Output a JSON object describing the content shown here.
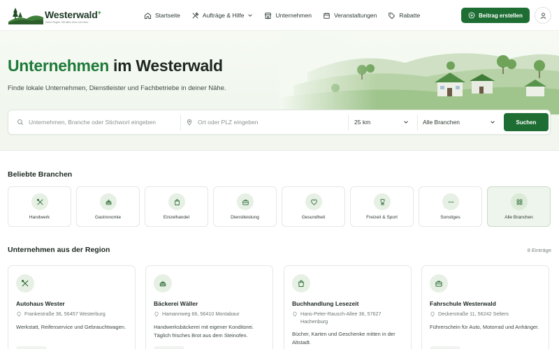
{
  "brand": {
    "name": "Westerwald",
    "plus": "+",
    "tagline": "Deine Region. Mit allem drum und dran."
  },
  "nav": {
    "items": [
      {
        "label": "Startseite",
        "icon": "home-icon"
      },
      {
        "label": "Aufträge & Hilfe",
        "icon": "tools-icon",
        "has_dropdown": true
      },
      {
        "label": "Unternehmen",
        "icon": "store-icon"
      },
      {
        "label": "Veranstaltungen",
        "icon": "calendar-icon"
      },
      {
        "label": "Rabatte",
        "icon": "tag-icon"
      }
    ],
    "create_button": "Beitrag erstellen",
    "user_icon": "user-icon"
  },
  "hero": {
    "title_highlight": "Unternehmen",
    "title_rest": " im Westerwald",
    "subtitle": "Finde lokale Unternehmen, Dienstleister und Fachbetriebe in deiner Nähe."
  },
  "search": {
    "query_placeholder": "Unternehmen, Branche oder Stichwort eingeben",
    "location_placeholder": "Ort oder PLZ eingeben",
    "radius": "25 km",
    "branch": "Alle Branchen",
    "button": "Suchen"
  },
  "categories": {
    "title": "Beliebte Branchen",
    "items": [
      {
        "label": "Handwerk",
        "icon": "tools-icon"
      },
      {
        "label": "Gastronomie",
        "icon": "cake-icon"
      },
      {
        "label": "Einzelhandel",
        "icon": "shopping-bag-icon"
      },
      {
        "label": "Dienstleistung",
        "icon": "briefcase-icon"
      },
      {
        "label": "Gesundheit",
        "icon": "heart-icon"
      },
      {
        "label": "Freizeit & Sport",
        "icon": "trophy-icon"
      },
      {
        "label": "Sonstiges",
        "icon": "more-icon"
      },
      {
        "label": "Alle Branchen",
        "icon": "grid-icon",
        "active": true
      }
    ]
  },
  "companies": {
    "title": "Unternehmen aus der Region",
    "count": "8 Einträge",
    "items": [
      {
        "name": "Autohaus Wester",
        "address": "Frankestraße 36, 56457 Westerburg",
        "description": "Werkstatt, Reifenservice und Gebrauchtwagen.",
        "icon": "tools-icon"
      },
      {
        "name": "Bäckerei Wäller",
        "address": "Hamannweg 66, 56410 Montabaur",
        "description": "Handwerksbäckerei mit eigener Konditorei. Täglich frisches Brot aus dem Steinofen.",
        "icon": "cake-icon"
      },
      {
        "name": "Buchhandlung Lesezeit",
        "address": "Hans-Peter-Rausch-Allee 36, 57627 Hachenburg",
        "description": "Bücher, Karten und Geschenke mitten in der Altstadt.",
        "icon": "shopping-bag-icon"
      },
      {
        "name": "Fahrschule Westerwald",
        "address": "Deckerstraße 11, 56242 Selters",
        "description": "Führerschein für Auto, Motorrad und Anhänger.",
        "icon": "briefcase-icon"
      }
    ]
  },
  "colors": {
    "primary": "#1e6e34",
    "highlight": "#1e7a3a",
    "icon_bg": "#e7f0e4",
    "hero_bg": "#f4f9f1"
  }
}
